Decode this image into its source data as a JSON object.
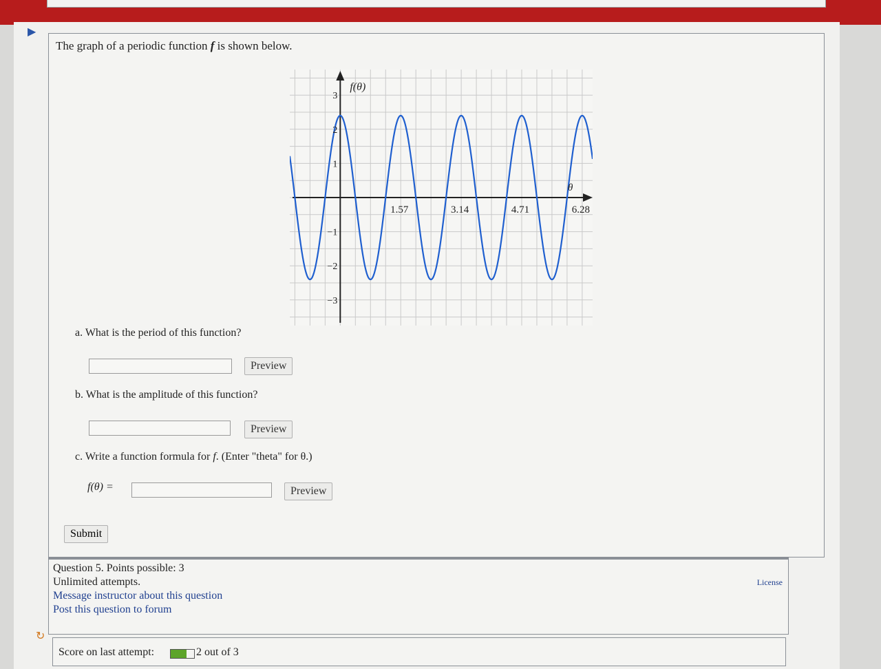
{
  "question": {
    "intro_prefix": "The graph of a periodic function ",
    "intro_symbol": "f",
    "intro_suffix": " is shown below."
  },
  "graph": {
    "y_axis_label": "f(θ)",
    "x_axis_label": "θ",
    "x_ticks": [
      "1.57",
      "3.14",
      "4.71",
      "6.28"
    ],
    "y_ticks": [
      "3",
      "2",
      "1",
      "−1",
      "−2",
      "−3"
    ],
    "curve_color": "#1f5fcf"
  },
  "chart_data": {
    "type": "line",
    "x_tick_labels": [
      "1.57",
      "3.14",
      "4.71",
      "6.28"
    ],
    "y_tick_labels": [
      "3",
      "2",
      "1",
      "−1",
      "−2",
      "−3"
    ],
    "xlim": [
      -1.31,
      6.55
    ],
    "ylim": [
      -3.75,
      3.75
    ],
    "series": [
      {
        "amplitude": 2.4,
        "period": 1.57,
        "phase": 0.0
      }
    ],
    "grid": true
  },
  "parts": {
    "a": {
      "label": "a. What is the period of this function?",
      "value": "",
      "preview": "Preview"
    },
    "b": {
      "label": "b. What is the amplitude of this function?",
      "value": "",
      "preview": "Preview"
    },
    "c": {
      "label_prefix": "c. Write a function formula for ",
      "label_symbol": "f",
      "label_suffix": ". (Enter \"theta\" for θ.)",
      "func_label": "f(θ) =",
      "value": "",
      "preview": "Preview"
    }
  },
  "submit_label": "Submit",
  "info": {
    "points": "Question 5. Points possible: 3",
    "attempts": "Unlimited attempts.",
    "message_link": "Message instructor about this question",
    "forum_link": "Post this question to forum",
    "license": "License"
  },
  "score": {
    "label": "Score on last attempt:",
    "value": "2 out of 3",
    "fraction": 0.667,
    "bar_color": "#5da42a"
  }
}
